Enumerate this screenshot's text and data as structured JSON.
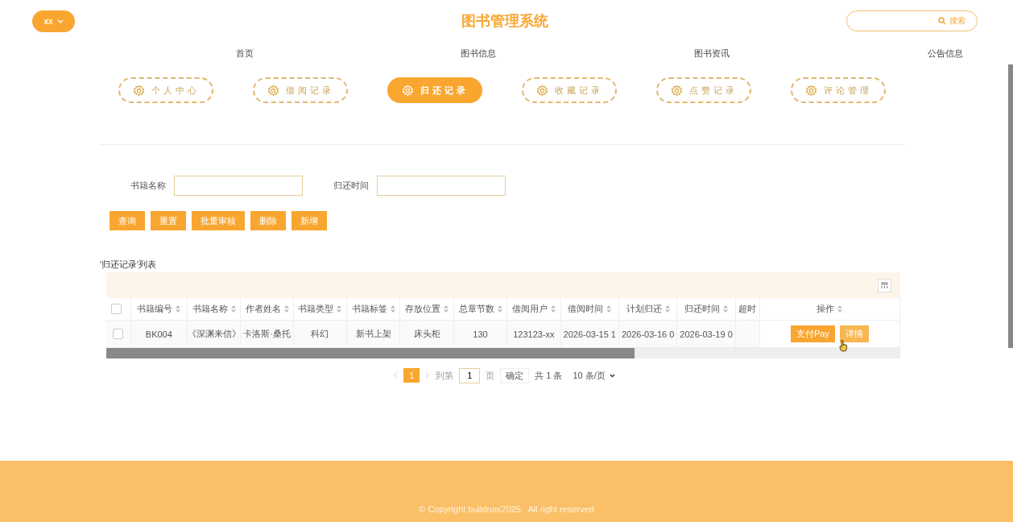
{
  "header": {
    "user_menu": "xx",
    "title": "图书管理系统",
    "search_button": "搜索"
  },
  "nav": [
    {
      "label": "首页"
    },
    {
      "label": "图书信息"
    },
    {
      "label": "图书资讯"
    },
    {
      "label": "公告信息"
    }
  ],
  "tabs": [
    {
      "label": "个人中心",
      "selected": false
    },
    {
      "label": "借阅记录",
      "selected": false
    },
    {
      "label": "归还记录",
      "selected": true
    },
    {
      "label": "收藏记录",
      "selected": false
    },
    {
      "label": "点赞记录",
      "selected": false
    },
    {
      "label": "评论管理",
      "selected": false
    }
  ],
  "filters": [
    {
      "label": "书籍名称"
    },
    {
      "label": "归还时间"
    }
  ],
  "actions": [
    "查询",
    "重置",
    "批量审核",
    "删除",
    "新增"
  ],
  "list_title": "'归还记录'列表",
  "table": {
    "header_checked": false,
    "columns": [
      {
        "label": "书籍编号",
        "sortable": true
      },
      {
        "label": "书籍名称",
        "sortable": true
      },
      {
        "label": "作者姓名",
        "sortable": true
      },
      {
        "label": "书籍类型",
        "sortable": true
      },
      {
        "label": "书籍标签",
        "sortable": true
      },
      {
        "label": "存放位置",
        "sortable": true
      },
      {
        "label": "总章节数",
        "sortable": true
      },
      {
        "label": "借阅用户",
        "sortable": true
      },
      {
        "label": "借阅时间",
        "sortable": true
      },
      {
        "label": "计划归还",
        "sortable": true
      },
      {
        "label": "归还时间",
        "sortable": true
      },
      {
        "label": "超时",
        "sortable": false
      },
      {
        "label": "操作",
        "sortable": true
      }
    ],
    "rows": [
      {
        "checked": false,
        "cells": [
          "BK004",
          "《深渊来信》",
          "卡洛斯·桑托",
          "科幻",
          "新书上架",
          "床头柜",
          "130",
          "123123-xx",
          "2026-03-15 1",
          "2026-03-16 0",
          "2026-03-19 0",
          ""
        ],
        "actions": [
          "支付Pay",
          "详情"
        ]
      }
    ]
  },
  "pagination": {
    "pages": [
      {
        "label": "1",
        "selected": true
      }
    ],
    "goto_label": "到第",
    "page_input": "1",
    "page_unit": "页",
    "confirm": "确定",
    "total": "共 1 条",
    "page_size": "10 条/页"
  },
  "footer": "© Copyright buildnox2025   All right reserved"
}
